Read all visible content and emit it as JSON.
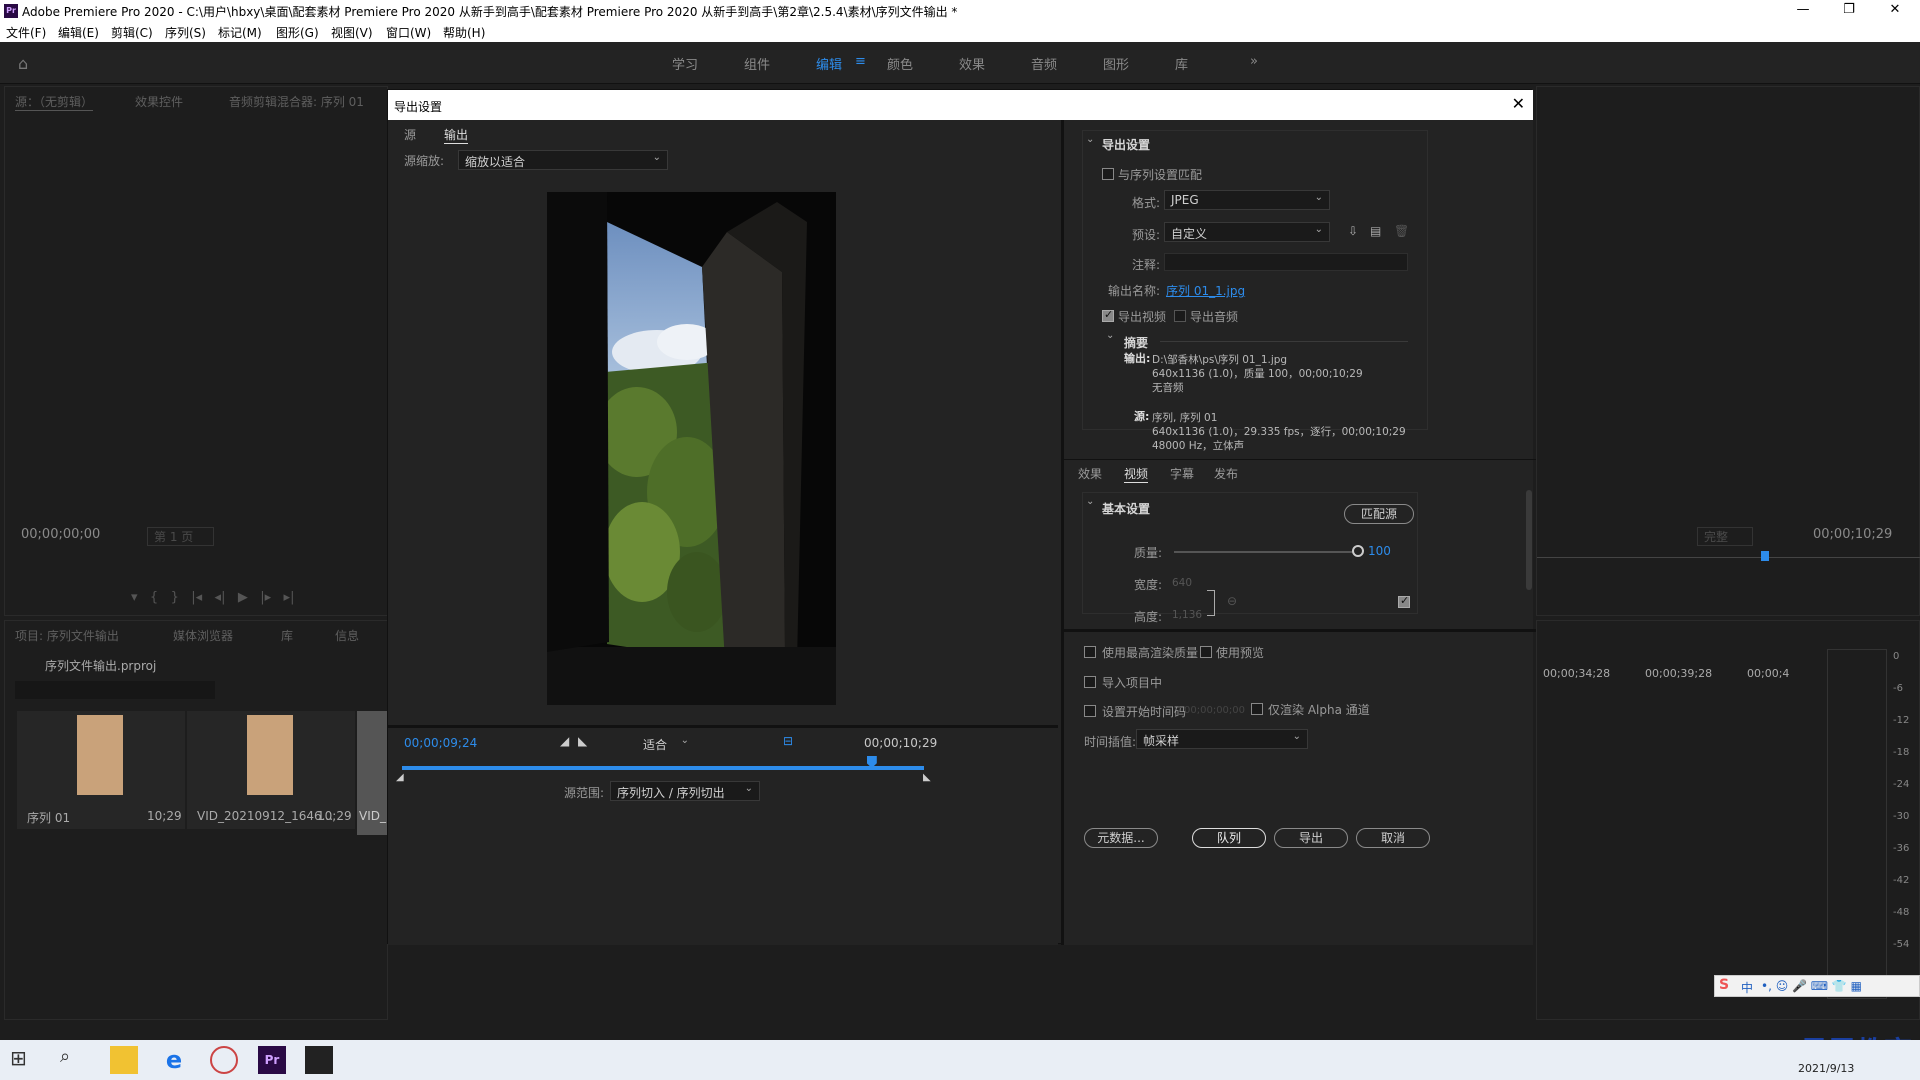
{
  "app": {
    "title": "Adobe Premiere Pro 2020 - C:\\用户\\hbxy\\桌面\\配套素材 Premiere Pro 2020 从新手到高手\\配套素材 Premiere Pro 2020 从新手到高手\\第2章\\2.5.4\\素材\\序列文件输出 *",
    "menus": [
      "文件(F)",
      "编辑(E)",
      "剪辑(C)",
      "序列(S)",
      "标记(M)",
      "图形(G)",
      "视图(V)",
      "窗口(W)",
      "帮助(H)"
    ],
    "workspaces": [
      "学习",
      "组件",
      "编辑",
      "颜色",
      "效果",
      "音频",
      "图形",
      "库"
    ],
    "active_workspace": "编辑"
  },
  "source_panel": {
    "tabs": [
      "源：（无剪辑）",
      "效果控件",
      "音频剪辑混合器: 序列 01"
    ],
    "timecode": "00;00;00;00",
    "page": "第 1 页"
  },
  "program_panel": {
    "quality": "完整",
    "timecode": "00;00;10;29"
  },
  "project_panel": {
    "tabs": [
      "项目: 序列文件输出",
      "媒体浏览器",
      "库",
      "信息"
    ],
    "project_file": "序列文件输出.prproj",
    "items": [
      {
        "name": "序列 01",
        "duration": "10;29"
      },
      {
        "name": "VID_20210912_1646...",
        "duration": "10;29"
      },
      {
        "name": "VID_",
        "duration": ""
      }
    ]
  },
  "timeline": {
    "marks": [
      "00;00;34;28",
      "00;00;39;28",
      "00;00;4"
    ],
    "meter": [
      "0",
      "-6",
      "-12",
      "-18",
      "-24",
      "-30",
      "-36",
      "-42",
      "-48",
      "-54"
    ]
  },
  "dialog": {
    "title": "导出设置",
    "left": {
      "tabs": [
        "源",
        "输出"
      ],
      "active_tab": "输出",
      "source_scale_label": "源缩放:",
      "source_scale_value": "缩放以适合",
      "current_time": "00;00;09;24",
      "fit_value": "适合",
      "end_time": "00;00;10;29",
      "playhead_fraction": 0.9,
      "source_range_label": "源范围:",
      "source_range_value": "序列切入 / 序列切出"
    },
    "export_settings": {
      "header": "导出设置",
      "match_sequence": "与序列设置匹配",
      "format_label": "格式:",
      "format_value": "JPEG",
      "preset_label": "预设:",
      "preset_value": "自定义",
      "comment_label": "注释:",
      "output_name_label": "输出名称:",
      "output_name_value": "序列 01_1.jpg",
      "export_video": "导出视频",
      "export_audio": "导出音频"
    },
    "summary": {
      "header": "摘要",
      "output_label": "输出:",
      "output_lines": [
        "D:\\邹香林\\ps\\序列 01_1.jpg",
        "640x1136 (1.0)，质量 100，00;00;10;29",
        "无音频"
      ],
      "source_label": "源:",
      "source_lines": [
        "序列, 序列 01",
        "640x1136 (1.0)，29.335 fps，逐行，00;00;10;29",
        "48000 Hz，立体声"
      ]
    },
    "tabs2": [
      "效果",
      "视频",
      "字幕",
      "发布"
    ],
    "active_tab2": "视频",
    "basic": {
      "header": "基本设置",
      "match_source": "匹配源",
      "quality_label": "质量:",
      "quality_value": "100",
      "quality_fraction": 1.0,
      "width_label": "宽度:",
      "width_value": "640",
      "height_label": "高度:",
      "height_value": "1,136"
    },
    "bottom": {
      "max_render": "使用最高渲染质量",
      "use_previews": "使用预览",
      "import_project": "导入项目中",
      "set_start_tc": "设置开始时间码",
      "start_tc_value": "00;00;00;00",
      "alpha_only": "仅渲染 Alpha 通道",
      "interp_label": "时间插值:",
      "interp_value": "帧采样",
      "metadata": "元数据...",
      "queue": "队列",
      "export": "导出",
      "cancel": "取消"
    }
  },
  "ime": {
    "lang": "中"
  },
  "watermark": "最需教育",
  "taskbar": {
    "date": "2021/9/13"
  }
}
